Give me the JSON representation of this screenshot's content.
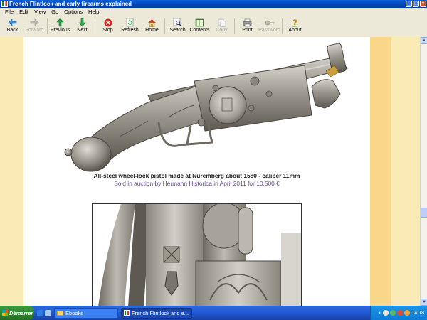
{
  "window": {
    "title": "French Flintlock and early firearms explained",
    "buttons": {
      "minimize": "_",
      "maximize": "□",
      "close": "×"
    }
  },
  "menu": [
    "File",
    "Edit",
    "View",
    "Go",
    "Options",
    "Help"
  ],
  "toolbar": {
    "back": "Back",
    "forward": "Forward",
    "previous": "Previous",
    "next": "Next",
    "stop": "Stop",
    "refresh": "Refresh",
    "home": "Home",
    "search": "Search",
    "contents": "Contents",
    "copy": "Copy",
    "print": "Print",
    "password": "Password",
    "about": "About"
  },
  "article": {
    "caption_title": "All-steel wheel-lock pistol made at Nuremberg about 1580  - caliber 11mm",
    "caption_sale": "Sold in auction by Hermann Historica in April 2011 for 10,500 €"
  },
  "taskbar": {
    "start": "Démarrer",
    "items": [
      "Ebooks",
      "French Flintlock and e..."
    ],
    "clock": "14:18"
  },
  "colors": {
    "page_bg": "#FAEBB6",
    "stripe": "#F8D78A",
    "caption_sale": "#6B4E8E"
  }
}
